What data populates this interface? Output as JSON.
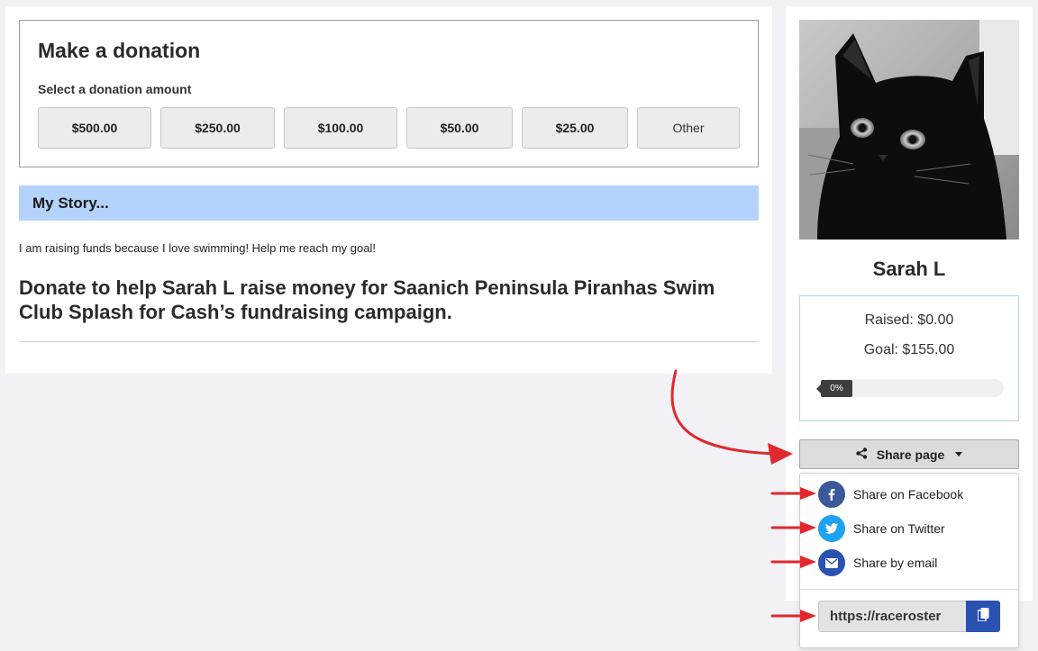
{
  "donation": {
    "title": "Make a donation",
    "subtitle": "Select a donation amount",
    "amounts": [
      "$500.00",
      "$250.00",
      "$100.00",
      "$50.00",
      "$25.00",
      "Other"
    ]
  },
  "story": {
    "heading": "My Story...",
    "text": "I am raising funds because I love swimming! Help me reach my goal!",
    "headline": "Donate to help Sarah L raise money for Saanich Peninsula Piranhas Swim Club Splash for Cash’s fundraising campaign."
  },
  "profile": {
    "name": "Sarah L",
    "raised": "Raised: $0.00",
    "goal": "Goal: $155.00",
    "progress_label": "0%",
    "progress_fraction": 0
  },
  "share": {
    "button_label": "Share page",
    "items": [
      {
        "label": "Share on Facebook",
        "icon": "facebook-icon",
        "color": "#3b5998"
      },
      {
        "label": "Share on Twitter",
        "icon": "twitter-icon",
        "color": "#1da1f2"
      },
      {
        "label": "Share by email",
        "icon": "envelope-icon",
        "color": "#2b52b3"
      }
    ],
    "url": "https://raceroster"
  },
  "colors": {
    "story_bar": "#b4d3fc",
    "annotation_arrow": "#e0282e",
    "copy_button": "#2b52b3"
  }
}
